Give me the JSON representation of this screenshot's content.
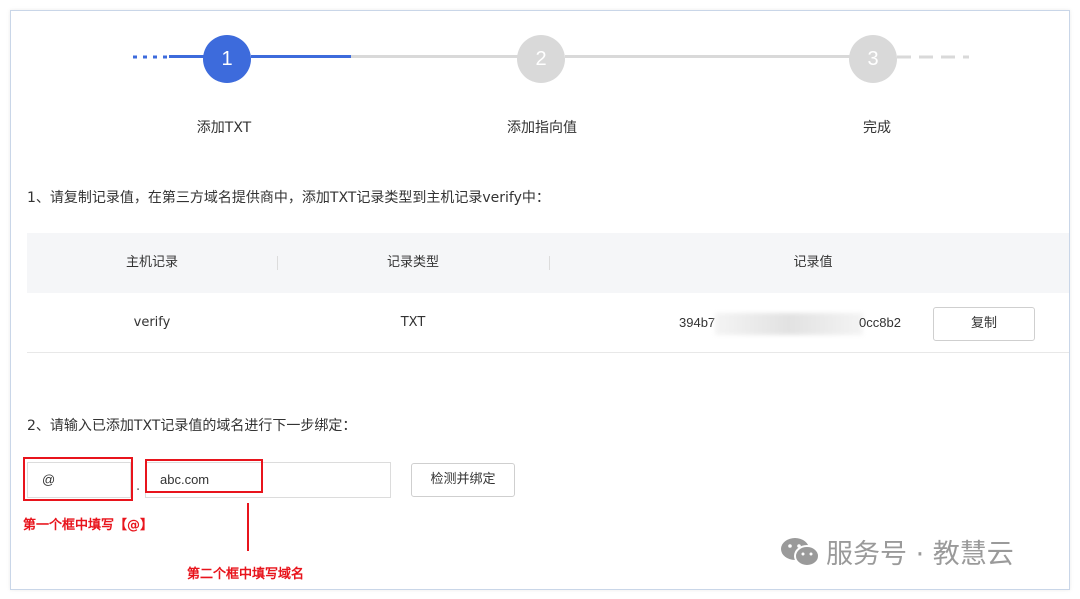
{
  "steps": [
    {
      "number": "1",
      "label": "添加TXT"
    },
    {
      "number": "2",
      "label": "添加指向值"
    },
    {
      "number": "3",
      "label": "完成"
    }
  ],
  "instruction1": "1、请复制记录值，在第三方域名提供商中，添加TXT记录类型到主机记录verify中：",
  "table": {
    "headers": [
      "主机记录",
      "记录类型",
      "记录值"
    ],
    "row": {
      "host": "verify",
      "type": "TXT",
      "value_prefix": "394b7",
      "value_suffix": "0cc8b2"
    },
    "copy_label": "复制"
  },
  "instruction2": "2、请输入已添加TXT记录值的域名进行下一步绑定：",
  "form": {
    "prefix_value": "@",
    "dot": ".",
    "domain_value": "abc.com",
    "submit_label": "检测并绑定"
  },
  "annotations": {
    "note1": "第一个框中填写【@】",
    "note2": "第二个框中填写域名"
  },
  "watermark": "服务号 · 教慧云",
  "colors": {
    "active": "#3d6bdc",
    "inactive": "#d9d9d9",
    "annotation": "#e8141c"
  }
}
